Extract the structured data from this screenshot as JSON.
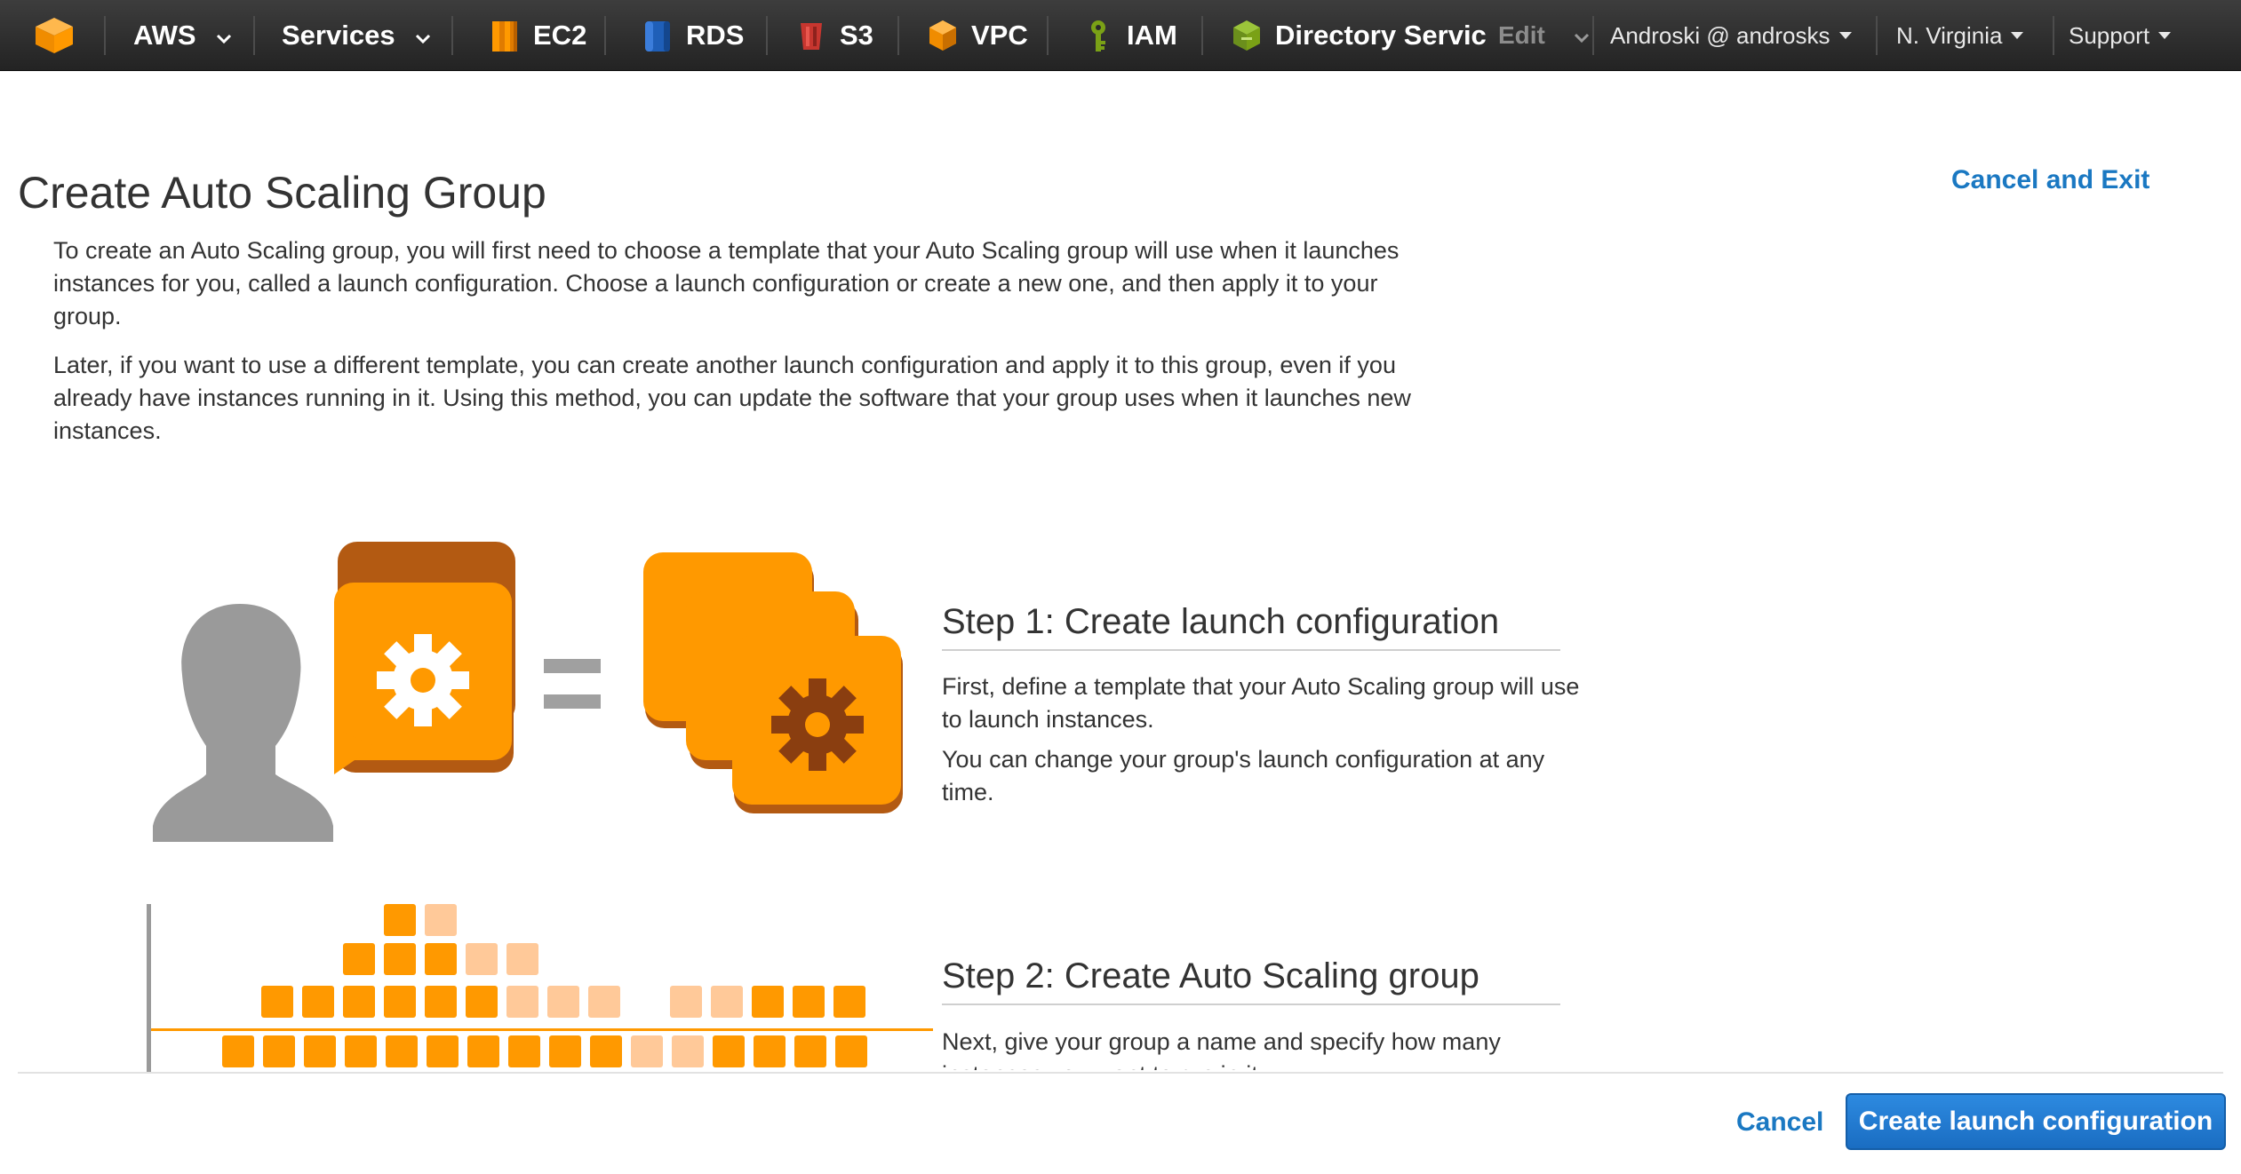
{
  "nav": {
    "brand": "AWS",
    "services": "Services",
    "shortcuts": [
      {
        "label": "EC2",
        "icon": "ec2-icon"
      },
      {
        "label": "RDS",
        "icon": "rds-icon"
      },
      {
        "label": "S3",
        "icon": "s3-icon"
      },
      {
        "label": "VPC",
        "icon": "vpc-icon"
      },
      {
        "label": "IAM",
        "icon": "iam-icon"
      },
      {
        "label": "Directory Servic",
        "icon": "directory-service-icon"
      }
    ],
    "edit": "Edit",
    "user": "Androski @ androsks",
    "region": "N. Virginia",
    "support": "Support"
  },
  "main": {
    "title": "Create Auto Scaling Group",
    "cancel_exit": "Cancel and Exit",
    "intro_1": "To create an Auto Scaling group, you will first need to choose a template that your Auto Scaling group will use when it launches instances for you, called a launch configuration. Choose a launch configuration or create a new one, and then apply it to your group.",
    "intro_2": "Later, if you want to use a different template, you can create another launch configuration and apply it to this group, even if you already have instances running in it. Using this method, you can update the software that your group uses when it launches new instances.",
    "step1": {
      "title": "Step 1: Create launch configuration",
      "p1": "First, define a template that your Auto Scaling group will use to launch instances.",
      "p2": "You can change your group's launch configuration at any time."
    },
    "step2": {
      "title": "Step 2: Create Auto Scaling group",
      "p1": "Next, give your group a name and specify how many instances you want to run in it."
    }
  },
  "footer": {
    "cancel": "Cancel",
    "primary": "Create launch configuration"
  },
  "colors": {
    "accent": "#1a78c2",
    "orange": "#ff9900",
    "orange_light": "#ffc999",
    "nav_bg": "#2d2d2d"
  }
}
